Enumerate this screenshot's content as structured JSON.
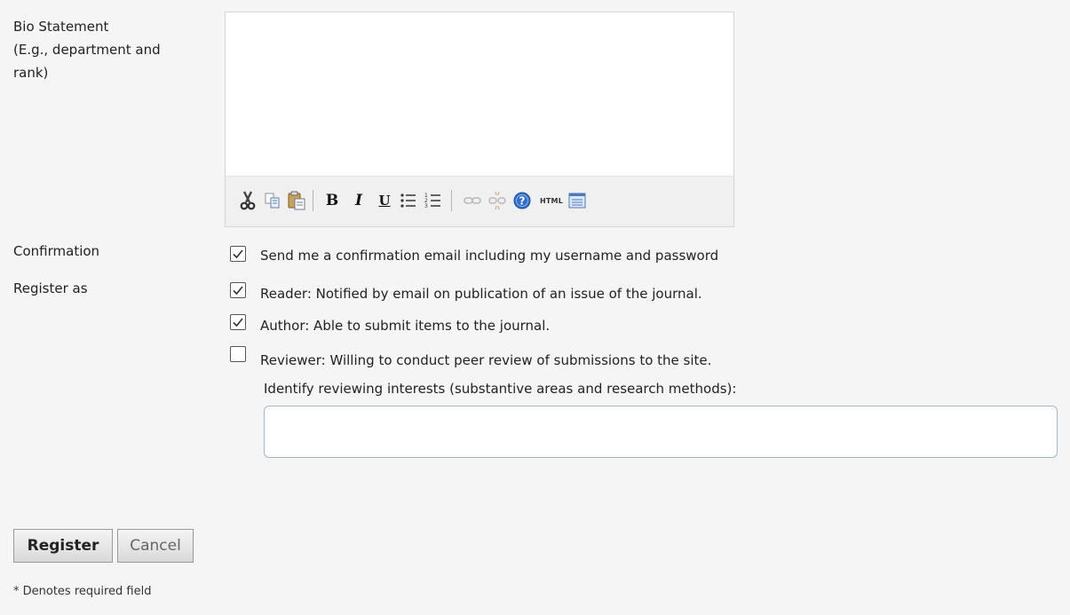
{
  "bio": {
    "label_line1": "Bio Statement",
    "label_line2": "(E.g., department and",
    "label_line3": "rank)",
    "value": ""
  },
  "toolbar": {
    "buttons": [
      {
        "icon": "cut-icon"
      },
      {
        "icon": "copy-icon"
      },
      {
        "icon": "paste-icon"
      },
      {
        "icon": "bold-icon",
        "glyph": "B"
      },
      {
        "icon": "italic-icon",
        "glyph": "I"
      },
      {
        "icon": "underline-icon",
        "glyph": "U"
      },
      {
        "icon": "bullet-list-icon"
      },
      {
        "icon": "numbered-list-icon"
      },
      {
        "icon": "link-icon"
      },
      {
        "icon": "unlink-icon"
      },
      {
        "icon": "help-icon",
        "glyph": "?"
      },
      {
        "icon": "html-icon",
        "glyph": "HTML"
      },
      {
        "icon": "fullscreen-icon"
      }
    ]
  },
  "confirmation": {
    "label": "Confirmation",
    "checkbox_label": "Send me a confirmation email including my username and password",
    "checked": true
  },
  "register_as": {
    "label": "Register as",
    "reader_label": "Reader: Notified by email on publication of an issue of the journal.",
    "reader_checked": true,
    "author_label": "Author: Able to submit items to the journal.",
    "author_checked": true,
    "reviewer_label": "Reviewer: Willing to conduct peer review of submissions to the site.",
    "reviewer_checked": false,
    "interests_label": "Identify reviewing interests (substantive areas and research methods):",
    "interests_value": ""
  },
  "actions": {
    "register_label": "Register",
    "cancel_label": "Cancel"
  },
  "footer": {
    "required_note": "* Denotes required field"
  },
  "colors": {
    "background": "#f5f5f5",
    "input_border": "#9fb6d4"
  }
}
